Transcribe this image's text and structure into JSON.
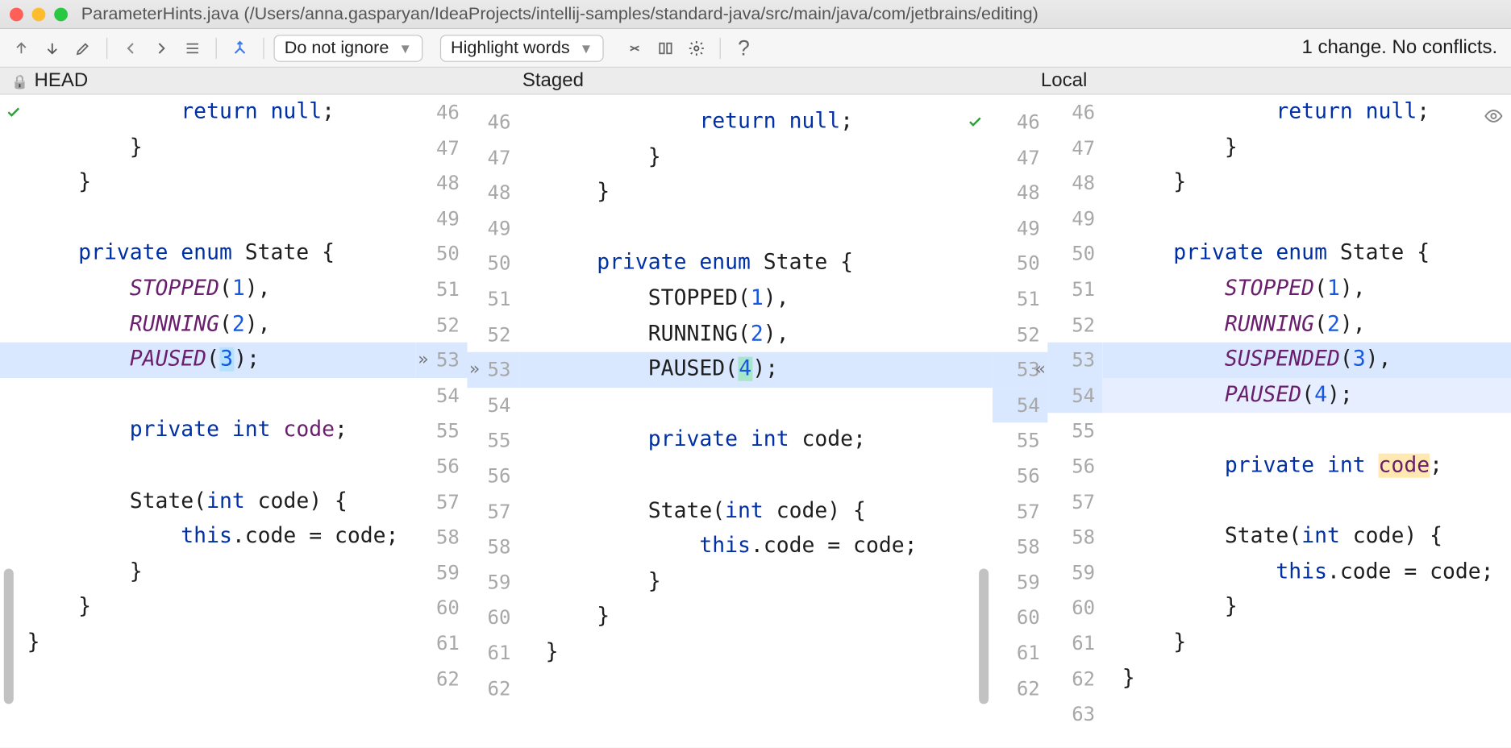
{
  "window": {
    "title": "ParameterHints.java (/Users/anna.gasparyan/IdeaProjects/intellij-samples/standard-java/src/main/java/com/jetbrains/editing)"
  },
  "traffic": {
    "close": "#ff5f57",
    "min": "#febc2e",
    "max": "#28c840"
  },
  "toolbar": {
    "ignore_select": "Do not ignore",
    "highlight_select": "Highlight words",
    "status": "1 change. No conflicts.",
    "help_glyph": "?"
  },
  "headers": {
    "head": "HEAD",
    "staged": "Staged",
    "local": "Local"
  },
  "gutters": {
    "head": [
      "46",
      "47",
      "48",
      "49",
      "50",
      "51",
      "52",
      "53",
      "54",
      "55",
      "56",
      "57",
      "58",
      "59",
      "60",
      "61",
      "62"
    ],
    "stagedL": [
      "46",
      "47",
      "48",
      "49",
      "50",
      "51",
      "52",
      "53",
      "54",
      "55",
      "56",
      "57",
      "58",
      "59",
      "60",
      "61",
      "62"
    ],
    "stagedR": [
      "46",
      "47",
      "48",
      "49",
      "50",
      "51",
      "52",
      "53",
      "54",
      "55",
      "56",
      "57",
      "58",
      "59",
      "60",
      "61",
      "62"
    ],
    "local": [
      "46",
      "47",
      "48",
      "49",
      "50",
      "51",
      "52",
      "53",
      "54",
      "55",
      "56",
      "57",
      "58",
      "59",
      "60",
      "61",
      "62",
      "63"
    ]
  },
  "code": {
    "head": {
      "l0a": "            ",
      "l0b": "return null",
      "l0c": ";",
      "l1": "        }",
      "l2": "    }",
      "l3": "",
      "l4a": "    ",
      "l4b": "private enum ",
      "l4c": "State {",
      "l5a": "        ",
      "l5b": "STOPPED",
      "l5c": "(",
      "l5d": "1",
      "l5e": "),",
      "l6a": "        ",
      "l6b": "RUNNING",
      "l6c": "(",
      "l6d": "2",
      "l6e": "),",
      "l7a": "        ",
      "l7b": "PAUSED",
      "l7c": "(",
      "l7d": "3",
      "l7e": ");",
      "l8": "",
      "l9a": "        ",
      "l9b": "private int ",
      "l9c": "code",
      ";": ";",
      "l10": "",
      "l11a": "        ",
      "l11b": "State(",
      "l11c": "int ",
      "l11d": "code) {",
      "l12a": "            ",
      "l12b": "this",
      "l12c": ".code = code;",
      "l13": "        }",
      "l14": "    }",
      "l15": "}",
      "l16": ""
    },
    "staged": {
      "l0a": "            ",
      "l0b": "return null",
      "l0c": ";",
      "l1": "        }",
      "l2": "    }",
      "l3": "",
      "l4a": "    ",
      "l4b": "private enum ",
      "l4c": "State {",
      "l5a": "        STOPPED(",
      "l5d": "1",
      "l5e": "),",
      "l6a": "        RUNNING(",
      "l6d": "2",
      "l6e": "),",
      "l7a": "        PAUSED(",
      "l7d": "4",
      "l7e": ");",
      "l8": "",
      "l9a": "        ",
      "l9b": "private int ",
      "l9c": "code;",
      "l10": "",
      "l11": "        State(",
      "l11c": "int ",
      "l11d": "code) {",
      "l12a": "            ",
      "l12b": "this",
      "l12c": ".code = code;",
      "l13": "        }",
      "l14": "    }",
      "l15": "}",
      "l16": ""
    },
    "local": {
      "l0a": "            ",
      "l0b": "return null",
      "l0c": ";",
      "l1": "        }",
      "l2": "    }",
      "l3": "",
      "l4a": "    ",
      "l4b": "private enum ",
      "l4c": "State {",
      "l5a": "        ",
      "l5b": "STOPPED",
      "l5c": "(",
      "l5d": "1",
      "l5e": "),",
      "l6a": "        ",
      "l6b": "RUNNING",
      "l6c": "(",
      "l6d": "2",
      "l6e": "),",
      "l7a": "        ",
      "l7b": "SUSPENDED",
      "l7c": "(",
      "l7d": "3",
      "l7e": "),",
      "l8a": "        ",
      "l8b": "PAUSED",
      "l8c": "(",
      "l8d": "4",
      "l8e": ");",
      "l9": "",
      "l10a": "        ",
      "l10b": "private int ",
      "l10c": "code",
      "l10d": ";",
      "l11": "",
      "l12a": "        ",
      "l12b": "State(",
      "l12c": "int ",
      "l12d": "code) {",
      "l13a": "            ",
      "l13b": "this",
      "l13c": ".code = code;",
      "l14": "        }",
      "l15": "    }",
      "l16": "}",
      "l17": ""
    }
  }
}
